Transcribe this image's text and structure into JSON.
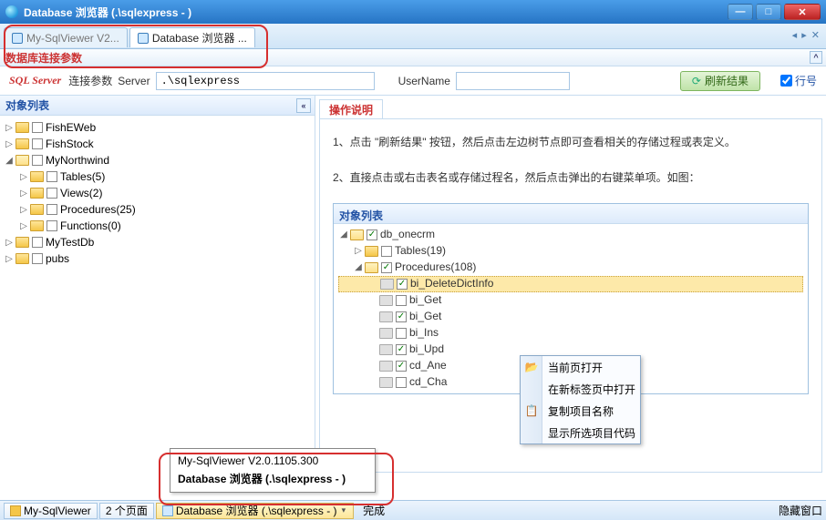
{
  "title": "Database 浏览器 (.\\sqlexpress - )",
  "tabs": {
    "t1": "My-SqlViewer V2...",
    "t2": "Database 浏览器 ..."
  },
  "section_header": "数据库连接参数",
  "conn": {
    "product": "SQL Server",
    "label_conn": "连接参数",
    "label_server": "Server",
    "server_value": ".\\sqlexpress",
    "label_user": "UserName",
    "user_value": "",
    "refresh": "刷新结果",
    "line_no": "行号"
  },
  "left": {
    "header": "对象列表",
    "nodes": {
      "n1": "FishEWeb",
      "n2": "FishStock",
      "n3": "MyNorthwind",
      "n3a": "Tables(5)",
      "n3b": "Views(2)",
      "n3c": "Procedures(25)",
      "n3d": "Functions(0)",
      "n4": "MyTestDb",
      "n5": "pubs"
    }
  },
  "right": {
    "tab": "操作说明",
    "p1": "1、点击 \"刷新结果\" 按钮，然后点击左边树节点即可查看相关的存储过程或表定义。",
    "p2": "2、直接点击或右击表名或存储过程名，然后点击弹出的右键菜单项。如图：",
    "inner_header": "对象列表",
    "inner": {
      "db": "db_onecrm",
      "t": "Tables(19)",
      "p": "Procedures(108)",
      "i1": "bi_DeleteDictInfo",
      "i2": "bi_Get",
      "i3": "bi_Get",
      "i4": "bi_Ins",
      "i5": "bi_Upd",
      "i6": "cd_Ane",
      "i7": "cd_Cha"
    }
  },
  "ctx": {
    "m1": "当前页打开",
    "m2": "在新标签页中打开",
    "m3": "复制项目名称",
    "m4": "显示所选项目代码"
  },
  "tooltip": {
    "l1": "My-SqlViewer V2.0.1105.300",
    "l2": "Database 浏览器 (.\\sqlexpress - )"
  },
  "status": {
    "s1": "My-SqlViewer",
    "s2": "2 个页面",
    "s3": "Database 浏览器 (.\\sqlexpress - )",
    "done": "完成",
    "hide": "隐藏窗口"
  }
}
